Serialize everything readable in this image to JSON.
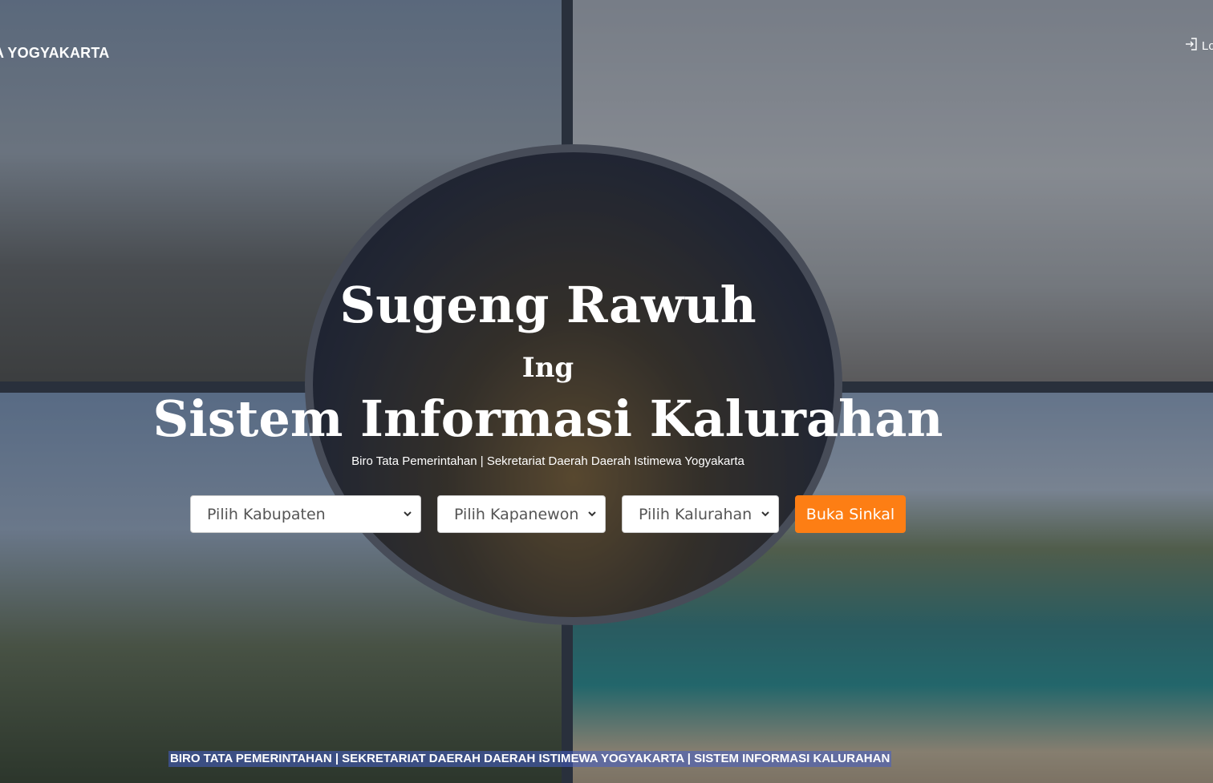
{
  "header": {
    "brand_text": "A YOGYAKARTA",
    "login_label": "Lo"
  },
  "hero": {
    "line1": "Sugeng Rawuh",
    "line2": "Ing",
    "line3": "Sistem Informasi Kalurahan",
    "subtitle": "Biro Tata Pemerintahan | Sekretariat Daerah Daerah Istimewa Yogyakarta"
  },
  "form": {
    "kabupaten_selected": "Pilih Kabupaten",
    "kapanewon_selected": "Pilih Kapanewon",
    "kalurahan_selected": "Pilih Kalurahan",
    "submit_label": "Buka Sinkal"
  },
  "ticker": {
    "text": "BIRO TATA PEMERINTAHAN | SEKRETARIAT DAERAH DAERAH ISTIMEWA YOGYAKARTA | SISTEM INFORMASI KALURAHAN"
  },
  "colors": {
    "accent": "#fd7e14",
    "ticker_highlight": "#465fc8"
  },
  "icons": {
    "login": "login-icon",
    "select_arrow": "chevron-down-icon"
  }
}
